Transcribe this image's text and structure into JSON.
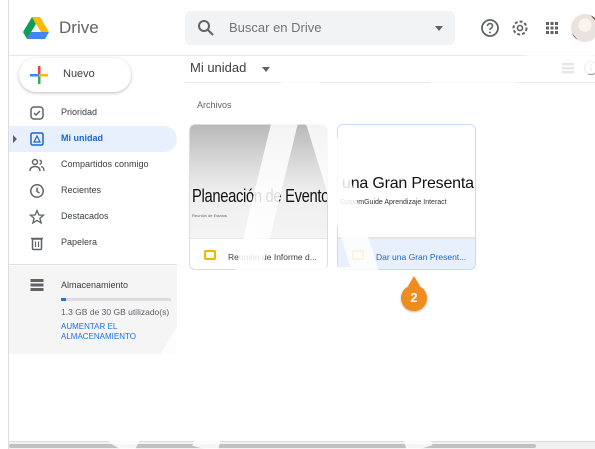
{
  "header": {
    "app_name": "Drive",
    "search_placeholder": "Buscar en Drive",
    "icons": [
      "drive-logo-icon",
      "search-icon",
      "help-icon",
      "settings-icon",
      "apps-grid-icon",
      "avatar"
    ]
  },
  "sidebar": {
    "new_label": "Nuevo",
    "items": [
      {
        "label": "Prioridad",
        "icon": "check-circle-icon"
      },
      {
        "label": "Mi unidad",
        "icon": "drive-icon",
        "active": true
      },
      {
        "label": "Compartidos conmigo",
        "icon": "people-icon"
      },
      {
        "label": "Recientes",
        "icon": "clock-icon"
      },
      {
        "label": "Destacados",
        "icon": "star-icon"
      },
      {
        "label": "Papelera",
        "icon": "trash-icon"
      }
    ],
    "storage": {
      "label": "Almacenamiento",
      "used_text": "1.3 GB de 30 GB utilizado(s)",
      "used_fraction": 0.043,
      "upgrade_label": "AUMENTAR EL ALMACENAMIENTO"
    }
  },
  "main": {
    "breadcrumb": "Mi unidad",
    "section_label": "Archivos",
    "files": [
      {
        "thumb_title": "Planeación de Evento",
        "thumb_subtitle": "Reunión de Estatus",
        "name": "Reunión de Informe d...",
        "type": "slides"
      },
      {
        "thumb_title": "una Gran Presenta",
        "thumb_subtitle": "CustomGuide Aprendizaje Interact",
        "name": "Dar una Gran Present...",
        "type": "slides",
        "selected": true
      }
    ]
  },
  "overlay": {
    "step_number": "2",
    "accent": "#f08b1e"
  },
  "colors": {
    "active_blue": "#1967d2",
    "active_bg": "#e8f0fe",
    "slides_yellow": "#f4b400"
  }
}
